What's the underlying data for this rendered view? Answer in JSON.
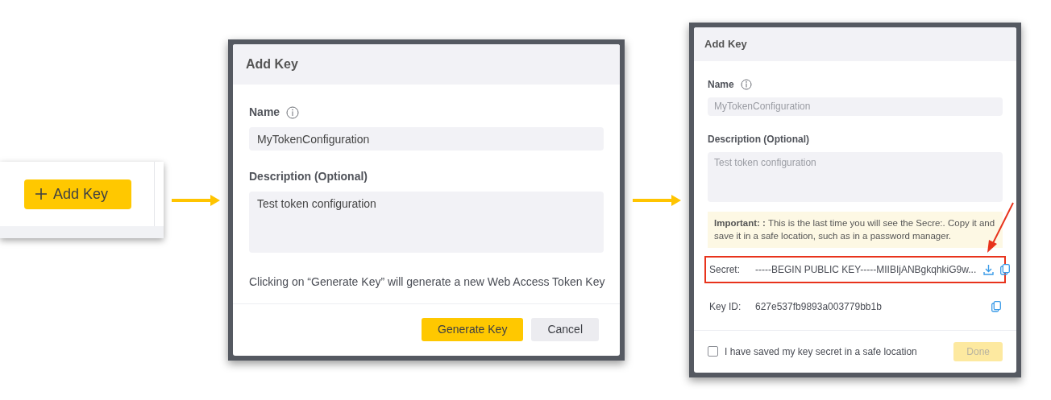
{
  "add_key_button": {
    "label": "Add Key"
  },
  "dialogs": [
    {
      "title": "Add Key",
      "fields": [
        {
          "kind": "input",
          "label": "Name",
          "info": true,
          "value": "MyTokenConfiguration",
          "disabled": false
        },
        {
          "kind": "textarea",
          "label": "Description (Optional)",
          "info": false,
          "value": "Test token configuration",
          "disabled": false
        }
      ],
      "note": "Clicking on “Generate Key” will generate a new Web Access Token Key",
      "buttons": [
        {
          "kind": "primary",
          "label": "Generate Key",
          "disabled": false
        },
        {
          "kind": "secondary",
          "label": "Cancel",
          "disabled": false
        }
      ]
    },
    {
      "title": "Add Key",
      "fields": [
        {
          "kind": "input",
          "label": "Name",
          "info": true,
          "value": "MyTokenConfiguration",
          "disabled": true
        },
        {
          "kind": "textarea",
          "label": "Description (Optional)",
          "info": false,
          "value": "Test token configuration",
          "disabled": true
        }
      ],
      "alert": "**Important: :** This is the last time you will see the Secre:. Copy it and save it in a safe location, such as in a password manager.",
      "key_rows": [
        {
          "label": "Secret:",
          "value": "-----BEGIN PUBLIC KEY-----MIIBIjANBgkqhkiG9w...",
          "download": true,
          "highlighted": true
        },
        {
          "label": "Key ID:",
          "value": "627e537fb9893a003779bb1b",
          "download": false,
          "highlighted": false
        }
      ],
      "checkbox": {
        "label": "I have saved my key secret in a safe location",
        "checked": false
      },
      "buttons": [
        {
          "kind": "primary",
          "label": "Done",
          "disabled": true
        }
      ]
    }
  ]
}
